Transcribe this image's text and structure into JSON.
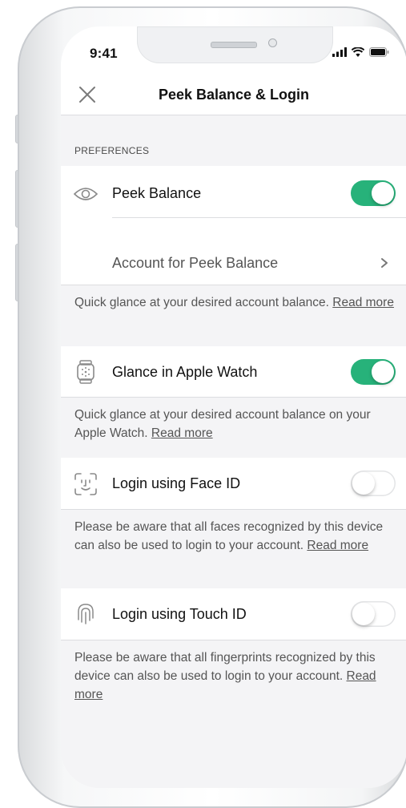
{
  "status_bar": {
    "time": "9:41"
  },
  "nav": {
    "title": "Peek Balance & Login",
    "close_icon": "close-icon"
  },
  "preferences": {
    "section_label": "PREFERENCES",
    "peek_balance": {
      "label": "Peek Balance",
      "enabled": true
    },
    "account": {
      "label": "Account for Peek Balance"
    },
    "peek_desc": "Quick glance at your desired account balance.",
    "glance_watch": {
      "label": "Glance in Apple Watch",
      "enabled": true
    },
    "watch_desc": "Quick glance at your desired account balance on your Apple Watch.",
    "face_id": {
      "label": "Login using Face ID",
      "enabled": false
    },
    "face_desc": "Please be aware that all faces recognized by this device can also be used to login to your account.",
    "touch_id": {
      "label": "Login using Touch ID",
      "enabled": false
    },
    "touch_desc": "Please be aware that all fingerprints recognized by this device can also be used to login to your account.",
    "read_more": "Read more"
  },
  "colors": {
    "toggle_on": "#27b27a",
    "background": "#f4f4f6"
  }
}
